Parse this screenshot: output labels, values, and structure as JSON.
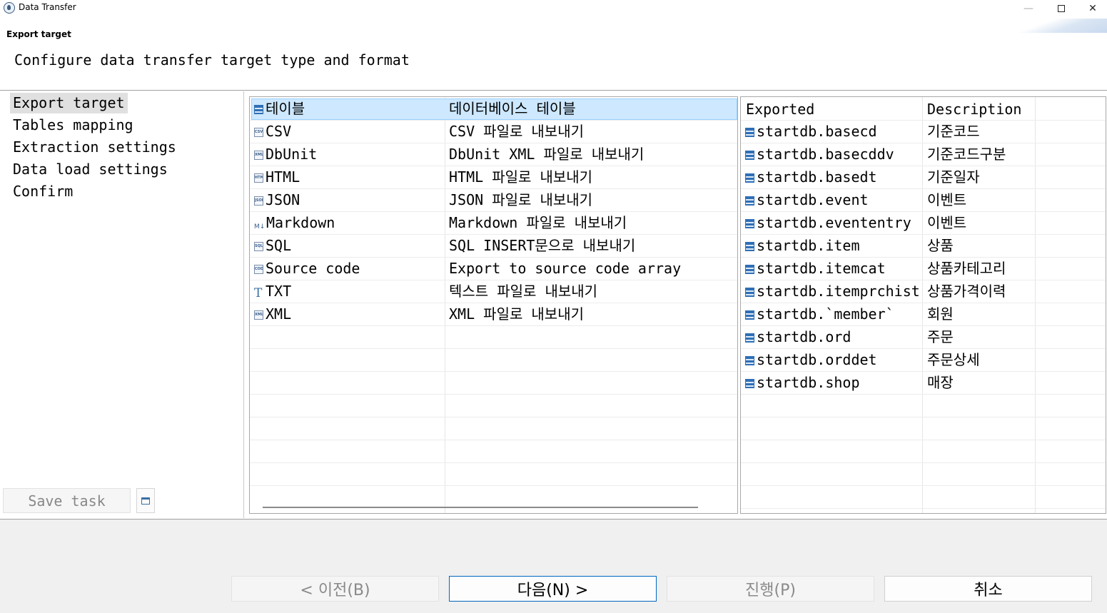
{
  "window": {
    "title": "Data Transfer",
    "min": "—",
    "close": "✕"
  },
  "header": {
    "heading": "Export target",
    "description": "Configure data transfer target type and format"
  },
  "nav": {
    "items": [
      {
        "label": "Export target",
        "selected": true
      },
      {
        "label": "Tables mapping"
      },
      {
        "label": "Extraction settings"
      },
      {
        "label": "Data load settings"
      },
      {
        "label": "Confirm"
      }
    ],
    "save_task": "Save task"
  },
  "formats": {
    "rows": [
      {
        "icon": "table-icon",
        "name": "테이블",
        "description": "데이터베이스 테이블",
        "selected": true
      },
      {
        "icon": "csv-file-icon",
        "badge": "CSV",
        "name": "CSV",
        "description": "CSV 파일로 내보내기"
      },
      {
        "icon": "xml-file-icon",
        "badge": "XML",
        "name": "DbUnit",
        "description": "DbUnit XML 파일로 내보내기"
      },
      {
        "icon": "html-file-icon",
        "badge": "HTML",
        "name": "HTML",
        "description": "HTML 파일로 내보내기"
      },
      {
        "icon": "json-file-icon",
        "badge": "JSON",
        "name": "JSON",
        "description": "JSON 파일로 내보내기"
      },
      {
        "icon": "markdown-icon",
        "badge": "M↓",
        "name": "Markdown",
        "description": "Markdown 파일로 내보내기"
      },
      {
        "icon": "sql-file-icon",
        "badge": "SQL",
        "name": "SQL",
        "description": "SQL INSERT문으로 내보내기"
      },
      {
        "icon": "code-file-icon",
        "badge": "CODE",
        "name": "Source code",
        "description": "Export to source code array"
      },
      {
        "icon": "text-icon",
        "badge": "T",
        "name": "TXT",
        "description": "텍스트 파일로 내보내기"
      },
      {
        "icon": "xml-file-icon",
        "badge": "XML",
        "name": "XML",
        "description": "XML 파일로 내보내기"
      }
    ]
  },
  "exported": {
    "columns": [
      "Exported",
      "Description"
    ],
    "rows": [
      {
        "name": "startdb.basecd",
        "description": "기준코드"
      },
      {
        "name": "startdb.basecddv",
        "description": "기준코드구분"
      },
      {
        "name": "startdb.basedt",
        "description": "기준일자"
      },
      {
        "name": "startdb.event",
        "description": "이벤트"
      },
      {
        "name": "startdb.evententry",
        "description": "이벤트"
      },
      {
        "name": "startdb.item",
        "description": "상품"
      },
      {
        "name": "startdb.itemcat",
        "description": "상품카테고리"
      },
      {
        "name": "startdb.itemprchist",
        "description": "상품가격이력"
      },
      {
        "name": "startdb.`member`",
        "description": "회원"
      },
      {
        "name": "startdb.ord",
        "description": "주문"
      },
      {
        "name": "startdb.orddet",
        "description": "주문상세"
      },
      {
        "name": "startdb.shop",
        "description": "매장"
      }
    ]
  },
  "buttons": {
    "back": "< 이전(B)",
    "next": "다음(N) >",
    "proceed": "진행(P)",
    "cancel": "취소"
  }
}
